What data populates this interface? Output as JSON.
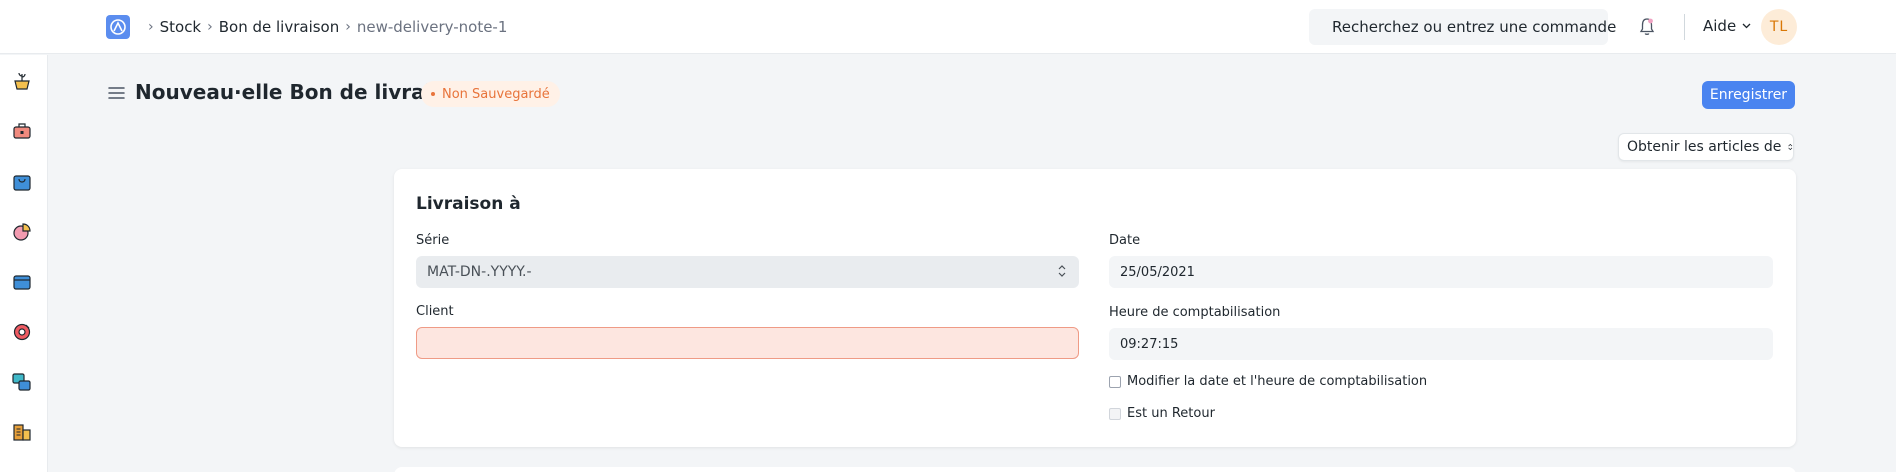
{
  "breadcrumb": {
    "items": [
      "Stock",
      "Bon de livraison",
      "new-delivery-note-1"
    ]
  },
  "navbar": {
    "search_placeholder": "Recherchez ou entrez une commande",
    "help_label": "Aide",
    "avatar_initials": "TL"
  },
  "page": {
    "title": "Nouveau·elle Bon de livraison",
    "status": "Non Sauvegardé",
    "save_label": "Enregistrer",
    "get_items_label": "Obtenir les articles de"
  },
  "form": {
    "section_title": "Livraison à",
    "series_label": "Série",
    "series_value": "MAT-DN-.YYYY.-",
    "client_label": "Client",
    "client_value": "",
    "date_label": "Date",
    "date_value": "25/05/2021",
    "posting_time_label": "Heure de comptabilisation",
    "posting_time_value": "09:27:15",
    "edit_posting_label": "Modifier la date et l'heure de comptabilisation",
    "is_return_label": "Est un Retour"
  },
  "sidebar": {
    "icons": [
      "plant-pot-icon",
      "toolbox-icon",
      "shopping-bag-icon",
      "pie-chart-icon",
      "wallet-icon",
      "support-icon",
      "stack-icon",
      "buildings-icon"
    ]
  },
  "colors": {
    "primary": "#4a84f0",
    "status_orange": "#e8743b",
    "required_bg": "#fde6e0"
  }
}
